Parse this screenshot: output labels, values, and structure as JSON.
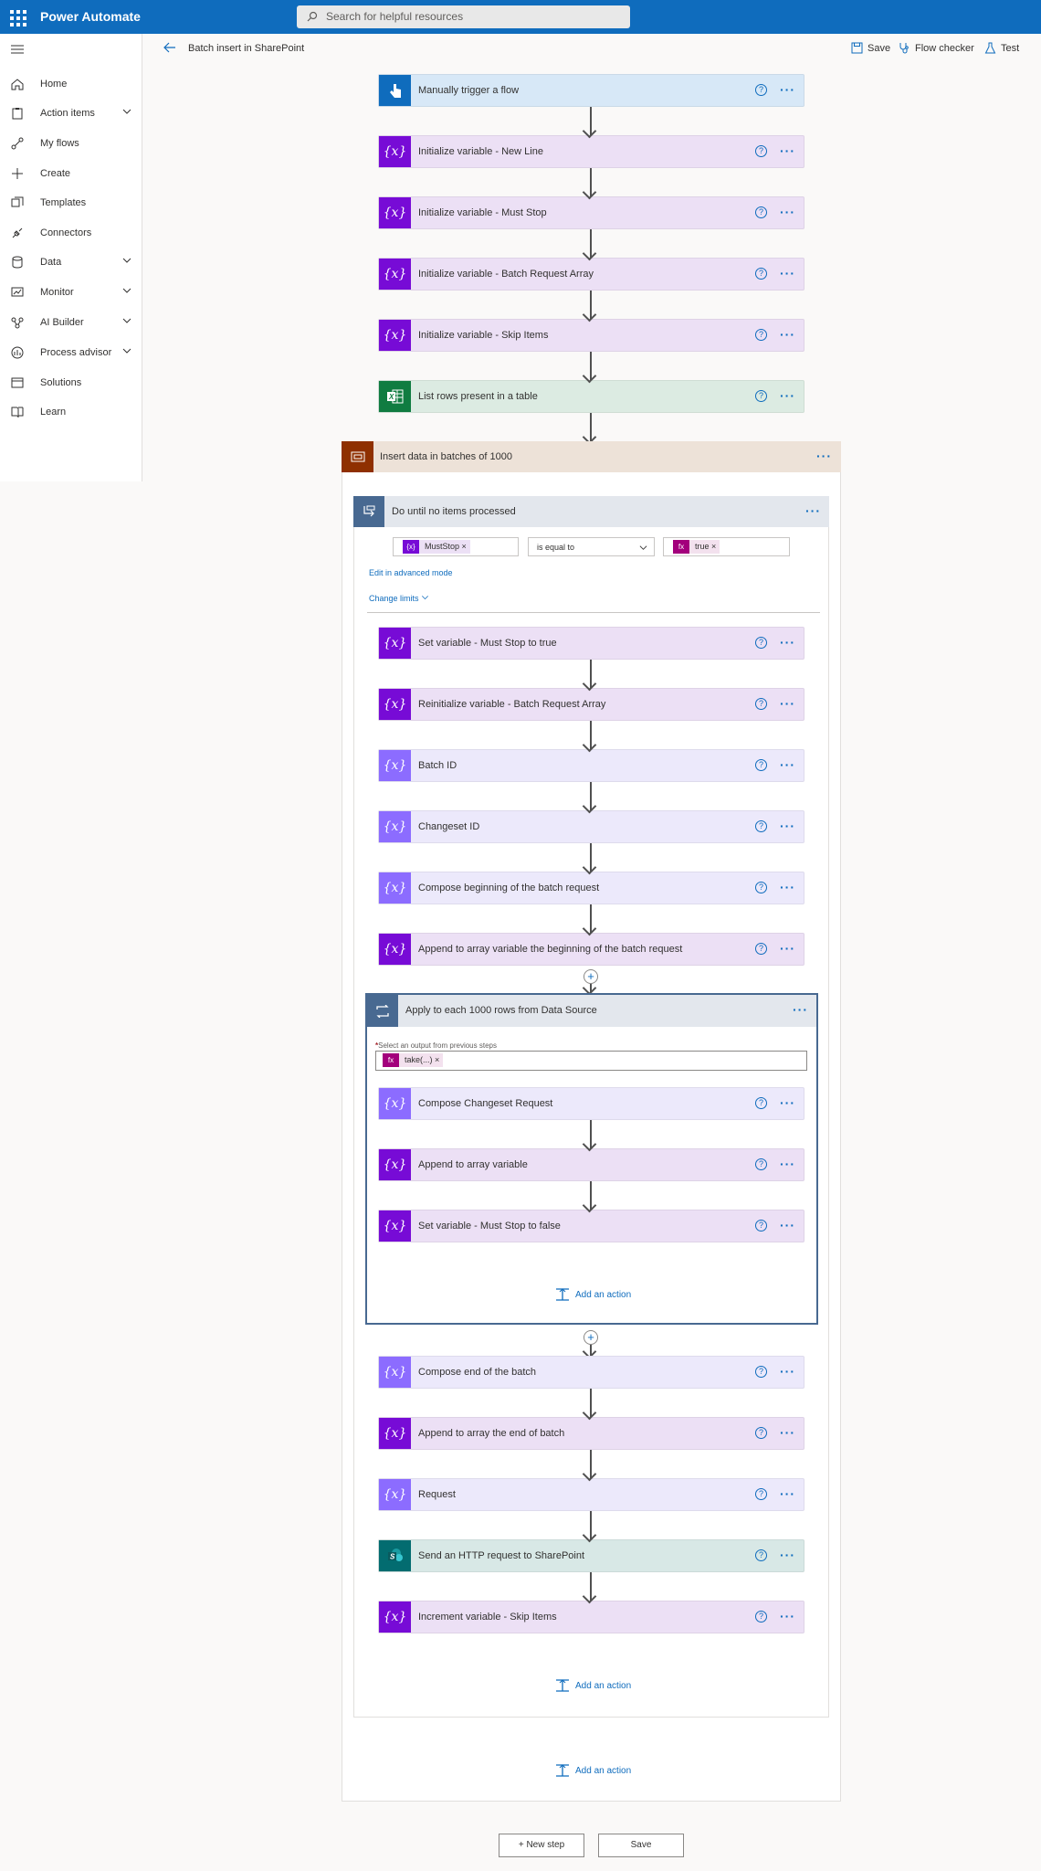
{
  "app": {
    "name": "Power Automate"
  },
  "search": {
    "placeholder": "Search for helpful resources"
  },
  "sidebar": {
    "items": [
      {
        "label": "Home"
      },
      {
        "label": "Action items"
      },
      {
        "label": "My flows"
      },
      {
        "label": "Create"
      },
      {
        "label": "Templates"
      },
      {
        "label": "Connectors"
      },
      {
        "label": "Data"
      },
      {
        "label": "Monitor"
      },
      {
        "label": "AI Builder"
      },
      {
        "label": "Process advisor"
      },
      {
        "label": "Solutions"
      },
      {
        "label": "Learn"
      }
    ]
  },
  "commandbar": {
    "flow_name": "Batch insert in SharePoint",
    "save": "Save",
    "flow_checker": "Flow checker",
    "test": "Test"
  },
  "top_steps": [
    {
      "label": "Manually trigger a flow",
      "type": "trigger"
    },
    {
      "label": "Initialize variable - New Line",
      "type": "variable"
    },
    {
      "label": "Initialize variable - Must Stop",
      "type": "variable"
    },
    {
      "label": "Initialize variable - Batch Request Array",
      "type": "variable"
    },
    {
      "label": "Initialize variable - Skip Items",
      "type": "variable"
    },
    {
      "label": "List rows present in a table",
      "type": "excel"
    }
  ],
  "scope": {
    "label": "Insert data in batches of 1000"
  },
  "do_until": {
    "label": "Do until no items processed",
    "condition_left": "MustStop",
    "condition_operator": "is equal to",
    "condition_right": "true",
    "edit_advanced": "Edit in advanced mode",
    "change_limits": "Change limits"
  },
  "until_steps": [
    {
      "label": "Set variable - Must Stop to true",
      "type": "variable"
    },
    {
      "label": "Reinitialize variable - Batch Request Array",
      "type": "variable"
    },
    {
      "label": "Batch ID",
      "type": "compose"
    },
    {
      "label": "Changeset ID",
      "type": "compose"
    },
    {
      "label": "Compose beginning of the batch request",
      "type": "compose"
    },
    {
      "label": "Append to array variable the beginning of the batch request",
      "type": "variable"
    }
  ],
  "apply_each": {
    "label": "Apply to each 1000 rows from Data Source",
    "select_label": "Select an output from previous steps",
    "required_marker": "*",
    "token": "take(...)",
    "steps": [
      {
        "label": "Compose Changeset Request",
        "type": "compose"
      },
      {
        "label": "Append to array variable",
        "type": "variable"
      },
      {
        "label": "Set variable - Must Stop to false",
        "type": "variable"
      }
    ],
    "add_action": "Add an action"
  },
  "after_steps": [
    {
      "label": "Compose end of the batch",
      "type": "compose"
    },
    {
      "label": "Append to array the end of batch",
      "type": "variable"
    },
    {
      "label": "Request",
      "type": "compose"
    },
    {
      "label": "Send an HTTP request to SharePoint",
      "type": "sharepoint"
    },
    {
      "label": "Increment variable - Skip Items",
      "type": "variable"
    }
  ],
  "add_action_until": "Add an action",
  "add_action_scope": "Add an action",
  "footer": {
    "new_step": "+ New step",
    "save": "Save"
  },
  "icons": {
    "variable": "{x}",
    "help": "?",
    "more": "···",
    "expression": "fx"
  },
  "colors": {
    "brand": "#0f6cbd",
    "variable": "#770bd6",
    "compose": "#8c6cff",
    "excel": "#107c41",
    "sharepoint": "#036c70",
    "scope": "#8f3000",
    "control": "#486991"
  }
}
